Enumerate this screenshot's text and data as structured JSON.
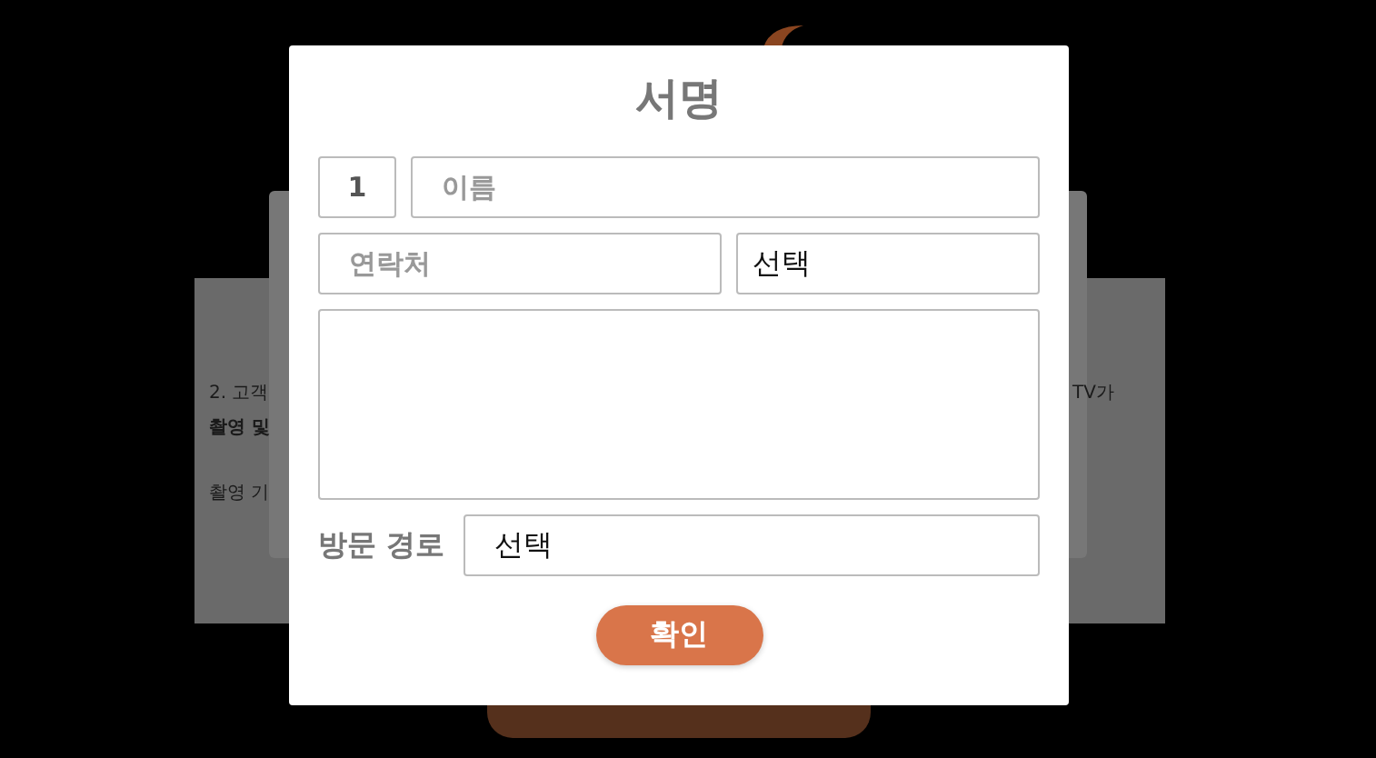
{
  "background": {
    "left_texts": [
      {
        "text": "2. 고객",
        "bold": false
      },
      {
        "text": "촬영 및",
        "bold": true
      },
      {
        "text": "촬영 기",
        "bold": false
      }
    ],
    "right_texts": [
      {
        "text": "TV가",
        "bold": false
      }
    ]
  },
  "dialog": {
    "title": "서명",
    "number": {
      "value": "1"
    },
    "name": {
      "placeholder": "이름"
    },
    "contact": {
      "placeholder": "연락처"
    },
    "contact_type": {
      "value": "선택"
    },
    "visit_route": {
      "label": "방문 경로",
      "value": "선택"
    },
    "confirm_button": "확인"
  }
}
